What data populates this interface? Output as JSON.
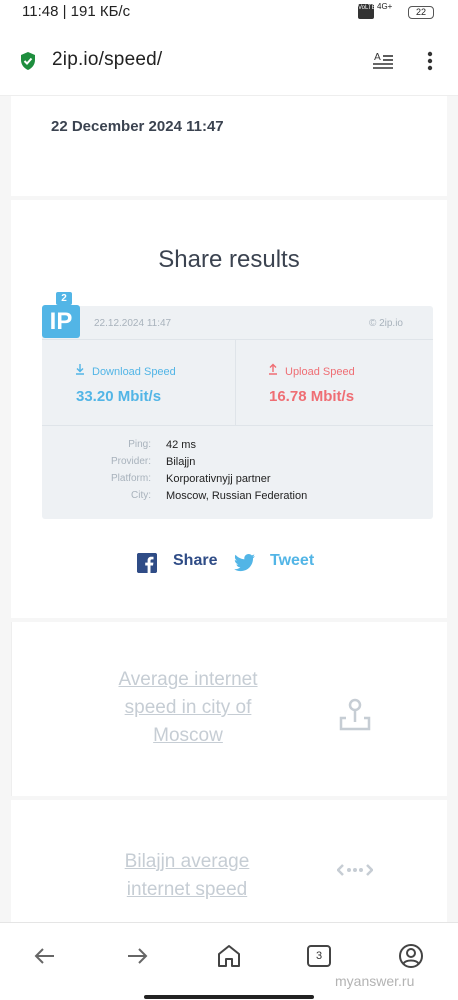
{
  "status": {
    "time": "11:48 | 191 КБ/с",
    "network": "4G+",
    "volte": "VoLTE",
    "battery": "22"
  },
  "browser": {
    "url": "2ip.io/speed/",
    "tabs_count": "3"
  },
  "header": {
    "date": "22 December 2024 11:47"
  },
  "share": {
    "title": "Share results",
    "card": {
      "logo": "IP",
      "logo_badge": "2",
      "date": "22.12.2024 11:47",
      "copyright": "© 2ip.io",
      "download_label": "Download Speed",
      "download_value": "33.20 Mbit/s",
      "upload_label": "Upload Speed",
      "upload_value": "16.78 Mbit/s",
      "info": [
        {
          "key": "Ping:",
          "value": "42 ms"
        },
        {
          "key": "Provider:",
          "value": "Bilajjn"
        },
        {
          "key": "Platform:",
          "value": "Korporativnyjj partner"
        },
        {
          "key": "City:",
          "value": "Moscow, Russian Federation"
        }
      ]
    },
    "facebook_label": "Share",
    "twitter_label": "Tweet"
  },
  "links": {
    "avg_city": "Average internet speed in city of Moscow",
    "isp_avg": "Bilajjn average internet speed"
  },
  "watermark": "myanswer.ru",
  "colors": {
    "download": "#52b5e6",
    "upload": "#ef6e74",
    "facebook": "#2f4c86",
    "link": "#c6cdd4"
  }
}
